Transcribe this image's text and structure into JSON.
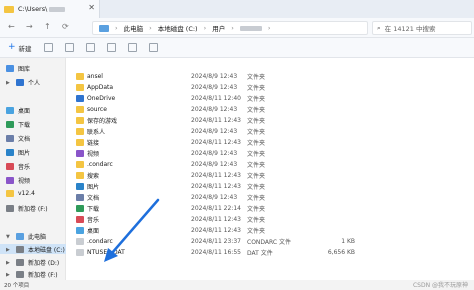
{
  "window": {
    "tab_title": "C:\\Users\\",
    "close_label": "✕"
  },
  "nav": {
    "back": "←",
    "forward": "→",
    "up": "↑",
    "refresh": "⟳"
  },
  "breadcrumb": {
    "items": [
      "此电脑",
      "本地磁盘 (C:)",
      "用户"
    ],
    "separator": "›"
  },
  "search": {
    "icon": "⌕",
    "placeholder": "在 14121 中搜索"
  },
  "toolbar": {
    "new_label": "新建",
    "new_icon": "+"
  },
  "sidebar": {
    "items": [
      {
        "label": "图库",
        "icon": "gallery-icon",
        "color": "#4a90e2"
      },
      {
        "label": "个人",
        "icon": "cloud-icon",
        "color": "#2f74d0"
      },
      {
        "label": "桌面",
        "icon": "desktop-icon",
        "color": "#4aa3e0"
      },
      {
        "label": "下载",
        "icon": "download-icon",
        "color": "#2f9b5a"
      },
      {
        "label": "文档",
        "icon": "document-icon",
        "color": "#6b7ea8"
      },
      {
        "label": "图片",
        "icon": "picture-icon",
        "color": "#2a83c9"
      },
      {
        "label": "音乐",
        "icon": "music-icon",
        "color": "#d84b57"
      },
      {
        "label": "视频",
        "icon": "video-icon",
        "color": "#8a55c9"
      },
      {
        "label": "v12.4",
        "icon": "folder-icon",
        "color": "#f4c542"
      },
      {
        "label": "新加卷 (F:)",
        "icon": "drive-icon",
        "color": "#7a7f86"
      },
      {
        "label": "此电脑",
        "icon": "pc-icon",
        "color": "#5aa0e0"
      },
      {
        "label": "本地磁盘 (C:)",
        "icon": "drive-icon",
        "color": "#7a7f86"
      },
      {
        "label": "新加卷 (D:)",
        "icon": "drive-icon",
        "color": "#7a7f86"
      },
      {
        "label": "新加卷 (F:)",
        "icon": "drive-icon",
        "color": "#7a7f86"
      }
    ]
  },
  "files": [
    {
      "name": "ansel",
      "date": "2024/8/9 12:43",
      "type": "文件夹",
      "size": "",
      "color": "#f4c542"
    },
    {
      "name": "AppData",
      "date": "2024/8/9 12:43",
      "type": "文件夹",
      "size": "",
      "color": "#f4c542"
    },
    {
      "name": "OneDrive",
      "date": "2024/8/11 12:40",
      "type": "文件夹",
      "size": "",
      "color": "#2f74d0"
    },
    {
      "name": "source",
      "date": "2024/8/9 12:43",
      "type": "文件夹",
      "size": "",
      "color": "#f4c542"
    },
    {
      "name": "保存的游戏",
      "date": "2024/8/11 12:43",
      "type": "文件夹",
      "size": "",
      "color": "#f4c542"
    },
    {
      "name": "联系人",
      "date": "2024/8/9 12:43",
      "type": "文件夹",
      "size": "",
      "color": "#f4c542"
    },
    {
      "name": "链接",
      "date": "2024/8/11 12:43",
      "type": "文件夹",
      "size": "",
      "color": "#f4c542"
    },
    {
      "name": "视频",
      "date": "2024/8/9 12:43",
      "type": "文件夹",
      "size": "",
      "color": "#8a55c9"
    },
    {
      "name": ".condarc",
      "date": "2024/8/9 12:43",
      "type": "文件夹",
      "size": "",
      "color": "#f4c542"
    },
    {
      "name": "搜索",
      "date": "2024/8/11 12:43",
      "type": "文件夹",
      "size": "",
      "color": "#f4c542"
    },
    {
      "name": "图片",
      "date": "2024/8/11 12:43",
      "type": "文件夹",
      "size": "",
      "color": "#2a83c9"
    },
    {
      "name": "文档",
      "date": "2024/8/9 12:43",
      "type": "文件夹",
      "size": "",
      "color": "#6b7ea8"
    },
    {
      "name": "下载",
      "date": "2024/8/11 22:14",
      "type": "文件夹",
      "size": "",
      "color": "#2f9b5a"
    },
    {
      "name": "音乐",
      "date": "2024/8/11 12:43",
      "type": "文件夹",
      "size": "",
      "color": "#d84b57"
    },
    {
      "name": "桌面",
      "date": "2024/8/11 12:43",
      "type": "文件夹",
      "size": "",
      "color": "#4aa3e0"
    },
    {
      "name": ".condarc",
      "date": "2024/8/11 23:37",
      "type": "CONDARC 文件",
      "size": "1 KB",
      "color": "#c9cdd2"
    },
    {
      "name": "NTUSER.DAT",
      "date": "2024/8/11 16:55",
      "type": "DAT 文件",
      "size": "6,656 KB",
      "color": "#c9cdd2"
    }
  ],
  "status": {
    "count": "20 个项目"
  },
  "watermark": "CSDN @我不玩原神"
}
